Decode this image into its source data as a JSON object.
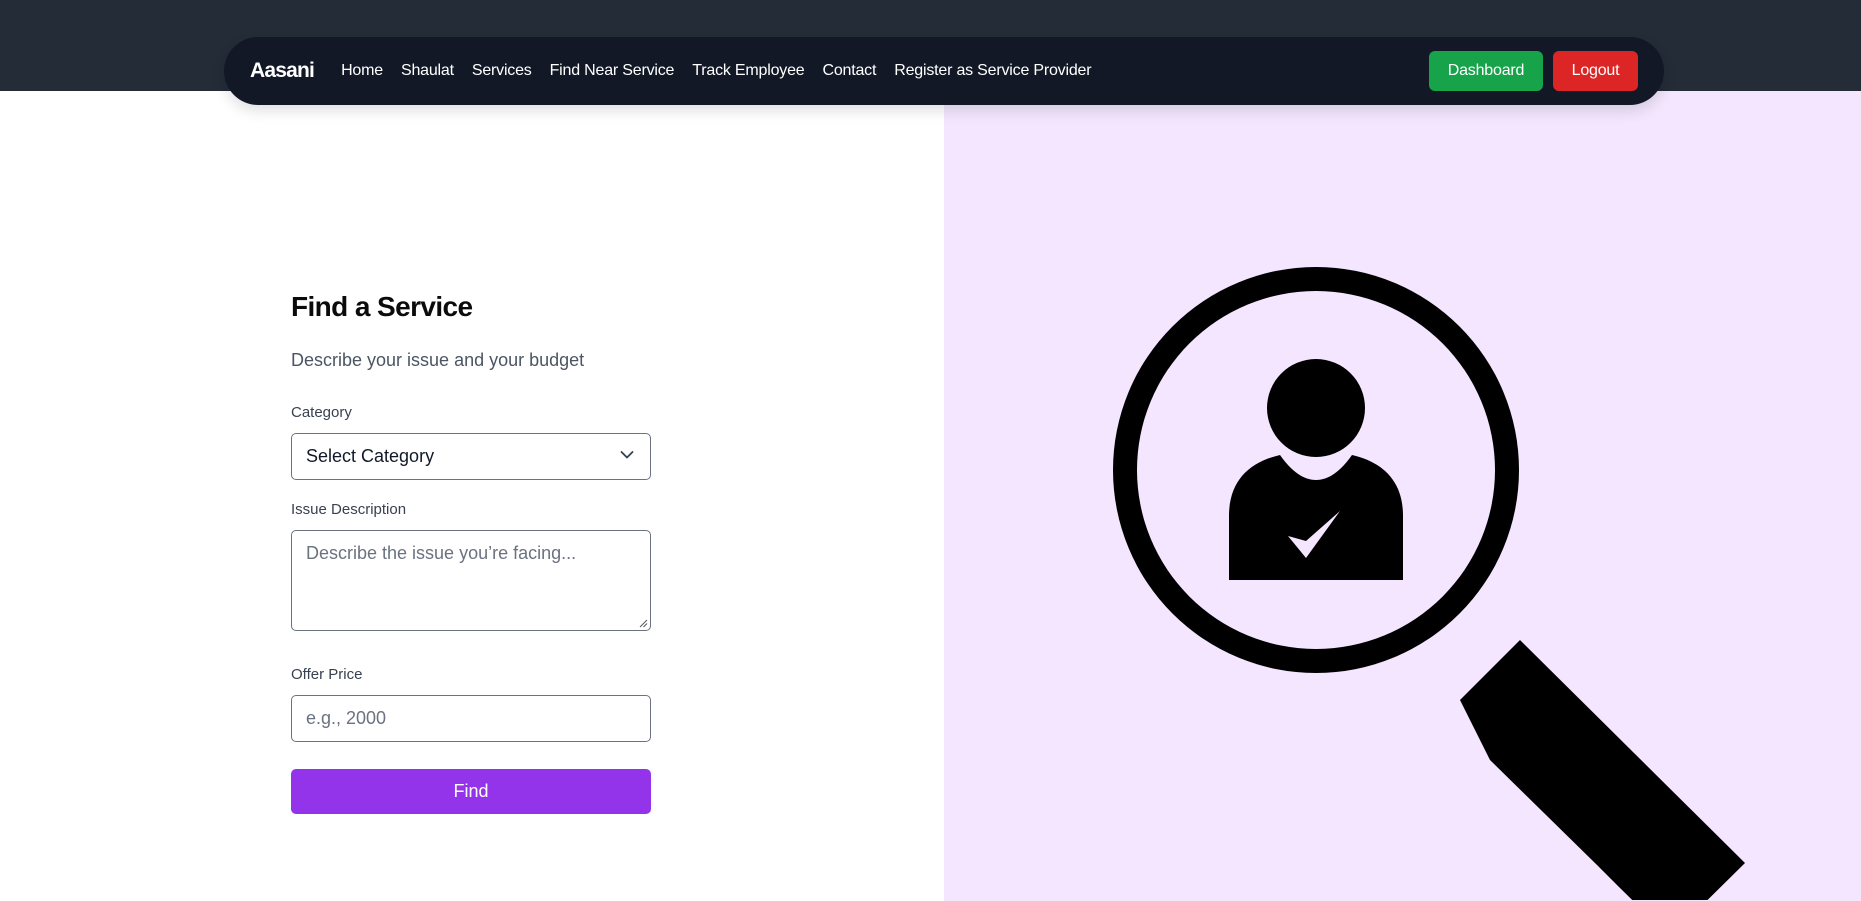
{
  "nav": {
    "brand": "Aasani",
    "links": [
      "Home",
      "Shaulat",
      "Services",
      "Find Near Service",
      "Track Employee",
      "Contact",
      "Register as Service Provider"
    ],
    "dashboard_label": "Dashboard",
    "logout_label": "Logout"
  },
  "form": {
    "title": "Find a Service",
    "subtitle": "Describe your issue and your budget",
    "category_label": "Category",
    "category_value": "Select Category",
    "issue_label": "Issue Description",
    "issue_placeholder": "Describe the issue you’re facing...",
    "price_label": "Offer Price",
    "price_placeholder": "e.g., 2000",
    "submit_label": "Find"
  },
  "colors": {
    "nav_bg": "#121826",
    "top_band": "#242c38",
    "dashboard": "#16a34a",
    "logout": "#dc2626",
    "accent": "#9333ea",
    "panel_bg": "#f3e6fe"
  },
  "icons": {
    "chevron": "chevron-down-icon",
    "illustration": "magnifier-person-check-icon"
  }
}
